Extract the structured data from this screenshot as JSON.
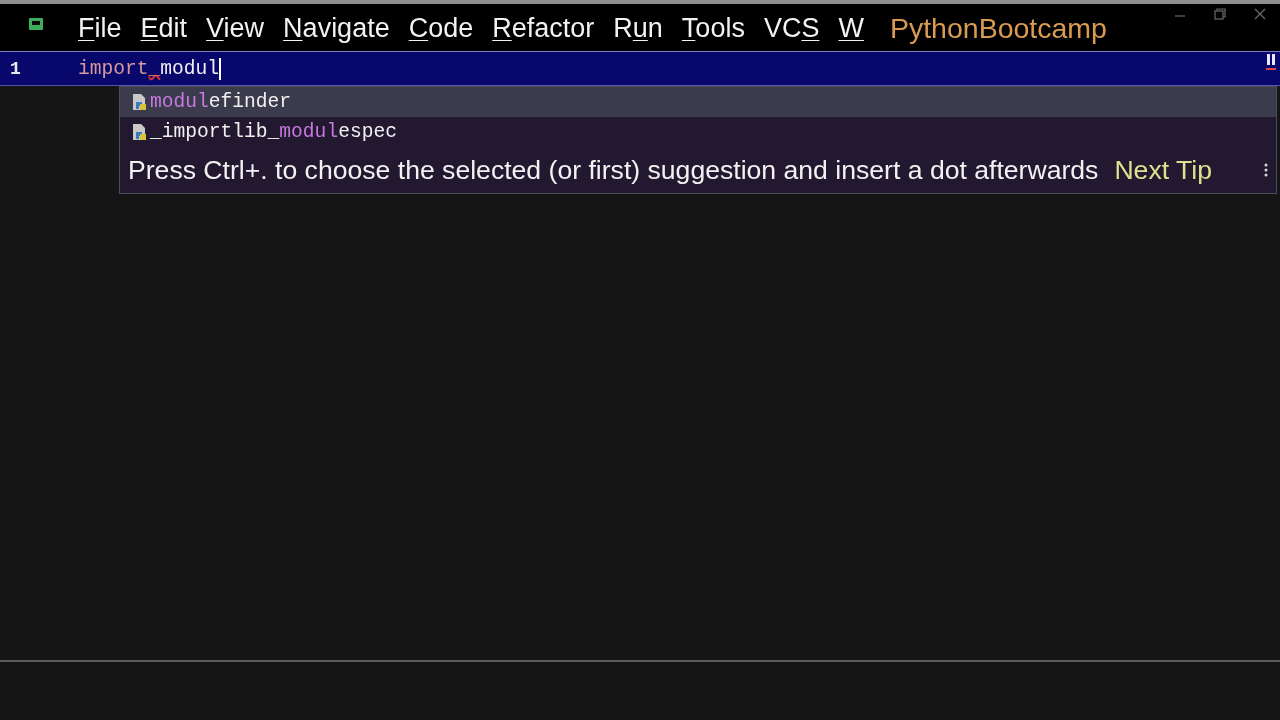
{
  "window": {
    "menu": [
      {
        "key": "F",
        "after": "ile"
      },
      {
        "key": "E",
        "after": "dit"
      },
      {
        "key": "V",
        "after": "iew"
      },
      {
        "key": "N",
        "after": "avigate"
      },
      {
        "key": "C",
        "after": "ode"
      },
      {
        "key": "R",
        "after": "efactor"
      },
      {
        "before": "R",
        "key": "u",
        "after": "n"
      },
      {
        "key": "T",
        "after": "ools"
      },
      {
        "before": "VC",
        "key": "S"
      },
      {
        "key": "W"
      }
    ],
    "project": "PythonBootcamp"
  },
  "editor": {
    "lines": [
      {
        "number": "1",
        "current": true,
        "caret": true,
        "tokens": [
          {
            "kind": "keyword",
            "text": "import"
          },
          {
            "kind": "error",
            "text": "_"
          },
          {
            "kind": "plain",
            "text": "modul"
          }
        ]
      }
    ]
  },
  "completion": {
    "items": [
      {
        "match": "modul",
        "after": "efinder",
        "selected": true
      },
      {
        "before": "_importlib_",
        "match": "modul",
        "after": "espec",
        "selected": false
      }
    ],
    "tip": "Press Ctrl+. to choose the selected (or first) suggestion and insert a dot afterwards",
    "next_tip": "Next Tip"
  }
}
